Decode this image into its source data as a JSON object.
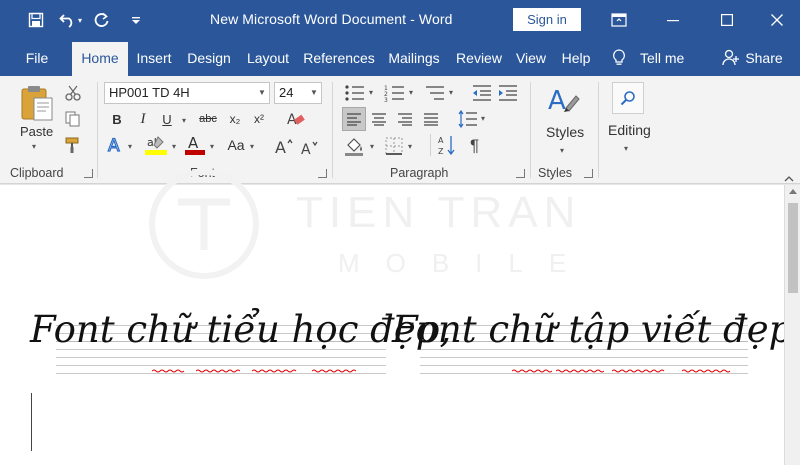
{
  "window": {
    "title": "New Microsoft Word Document  -  Word",
    "signin_label": "Sign in"
  },
  "tabs": [
    "File",
    "Home",
    "Insert",
    "Design",
    "Layout",
    "References",
    "Mailings",
    "Review",
    "View",
    "Help"
  ],
  "tell_me": "Tell me",
  "share": "Share",
  "clipboard": {
    "paste_label": "Paste",
    "group_label": "Clipboard"
  },
  "font": {
    "font_name": "HP001 TD 4H",
    "font_size": "24",
    "group_label": "Font",
    "case_label": "Aa",
    "bold": "B",
    "italic": "I",
    "underline": "U",
    "strike": "abc",
    "subscript": "x₂",
    "superscript": "x²"
  },
  "paragraph": {
    "group_label": "Paragraph"
  },
  "styles": {
    "button_label": "Styles",
    "group_label": "Styles"
  },
  "editing": {
    "button_label": "Editing"
  },
  "document": {
    "line1": "Font chữ tiểu học đẹp,",
    "line2": "Font chữ tập viết đẹp"
  },
  "watermark": {
    "line1": "TIEN TRAN",
    "line2": "MOBILE"
  },
  "colors": {
    "word_blue": "#2b579a",
    "highlight": "#ffff00",
    "font_color": "#c00000",
    "spell_squiggle": "#e00000"
  }
}
